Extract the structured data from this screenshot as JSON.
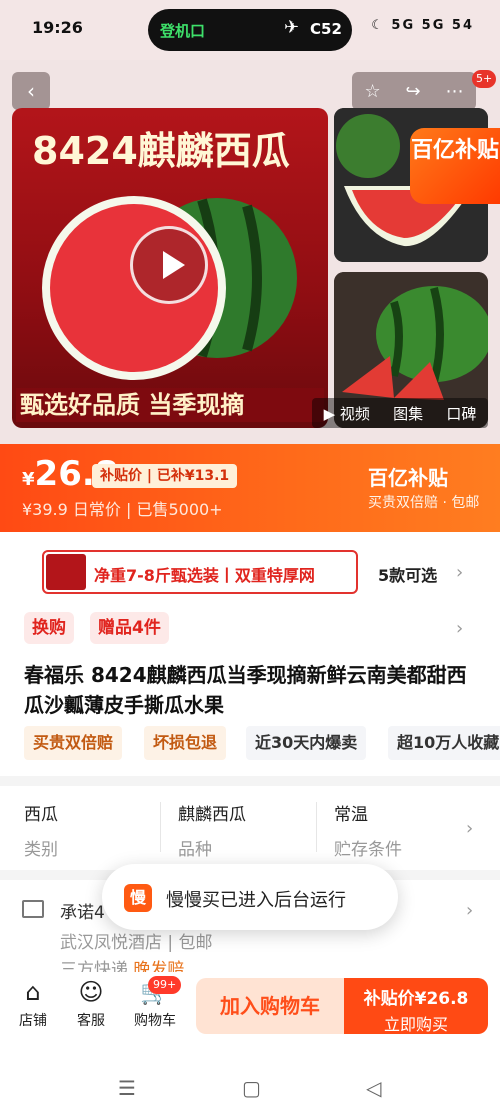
{
  "status_bar": {
    "time": "19:26",
    "island_left": "登机口",
    "island_plane": "✈",
    "island_right": "C52",
    "icons": "☾ 5G 5G 54"
  },
  "gallery": {
    "back_icon": "‹",
    "star_icon": "☆",
    "share_icon": "↪",
    "more_icon": "⋯",
    "badge": "5+",
    "main_title": "8424麒麟西瓜",
    "main_caption": "甄选好品质 当季现摘",
    "promo_tag": "百亿补贴",
    "tabs": [
      "▶ 视频",
      "图集",
      "口碑"
    ]
  },
  "price": {
    "currency": "¥",
    "value": "26.8",
    "chip": "补贴价 | 已补¥13.1",
    "sub": "¥39.9  日常价  |  已售5000+",
    "brand": "百亿补贴",
    "brand_sub": "买贵双倍赔 · 包邮"
  },
  "spec": {
    "text": "净重7-8斤甄选装丨双重特厚网",
    "count": "5款可选"
  },
  "tags": [
    "换购",
    "赠品4件"
  ],
  "title": "春福乐 8424麒麟西瓜当季现摘新鲜云南美都甜西瓜沙瓤薄皮手撕瓜水果",
  "features": [
    "买贵双倍赔",
    "坏损包退",
    "近30天内爆卖",
    "超10万人收藏"
  ],
  "attributes": [
    {
      "value": "西瓜",
      "key": "类别"
    },
    {
      "value": "麒麟西瓜",
      "key": "品种"
    },
    {
      "value": "常温",
      "key": "贮存条件"
    }
  ],
  "shipping": {
    "title": "承诺4",
    "line2": "武汉凤悦酒店 | 包邮",
    "line3_prefix": "三方快递",
    "line3_highlight": "晚发赔"
  },
  "toast": {
    "logo": "慢",
    "text": "慢慢买已进入后台运行"
  },
  "bottom_bar": {
    "store": "店铺",
    "service": "客服",
    "cart": "购物车",
    "cart_badge": "99+",
    "add_cart": "加入购物车",
    "buy_price": "补贴价¥26.8",
    "buy_label": "立即购买"
  },
  "sys_nav": {
    "menu": "☰",
    "home": "▢",
    "back": "◁"
  },
  "colors": {
    "accent": "#ff4a14",
    "red": "#e0241e",
    "brand_orange": "#ff7d20"
  }
}
